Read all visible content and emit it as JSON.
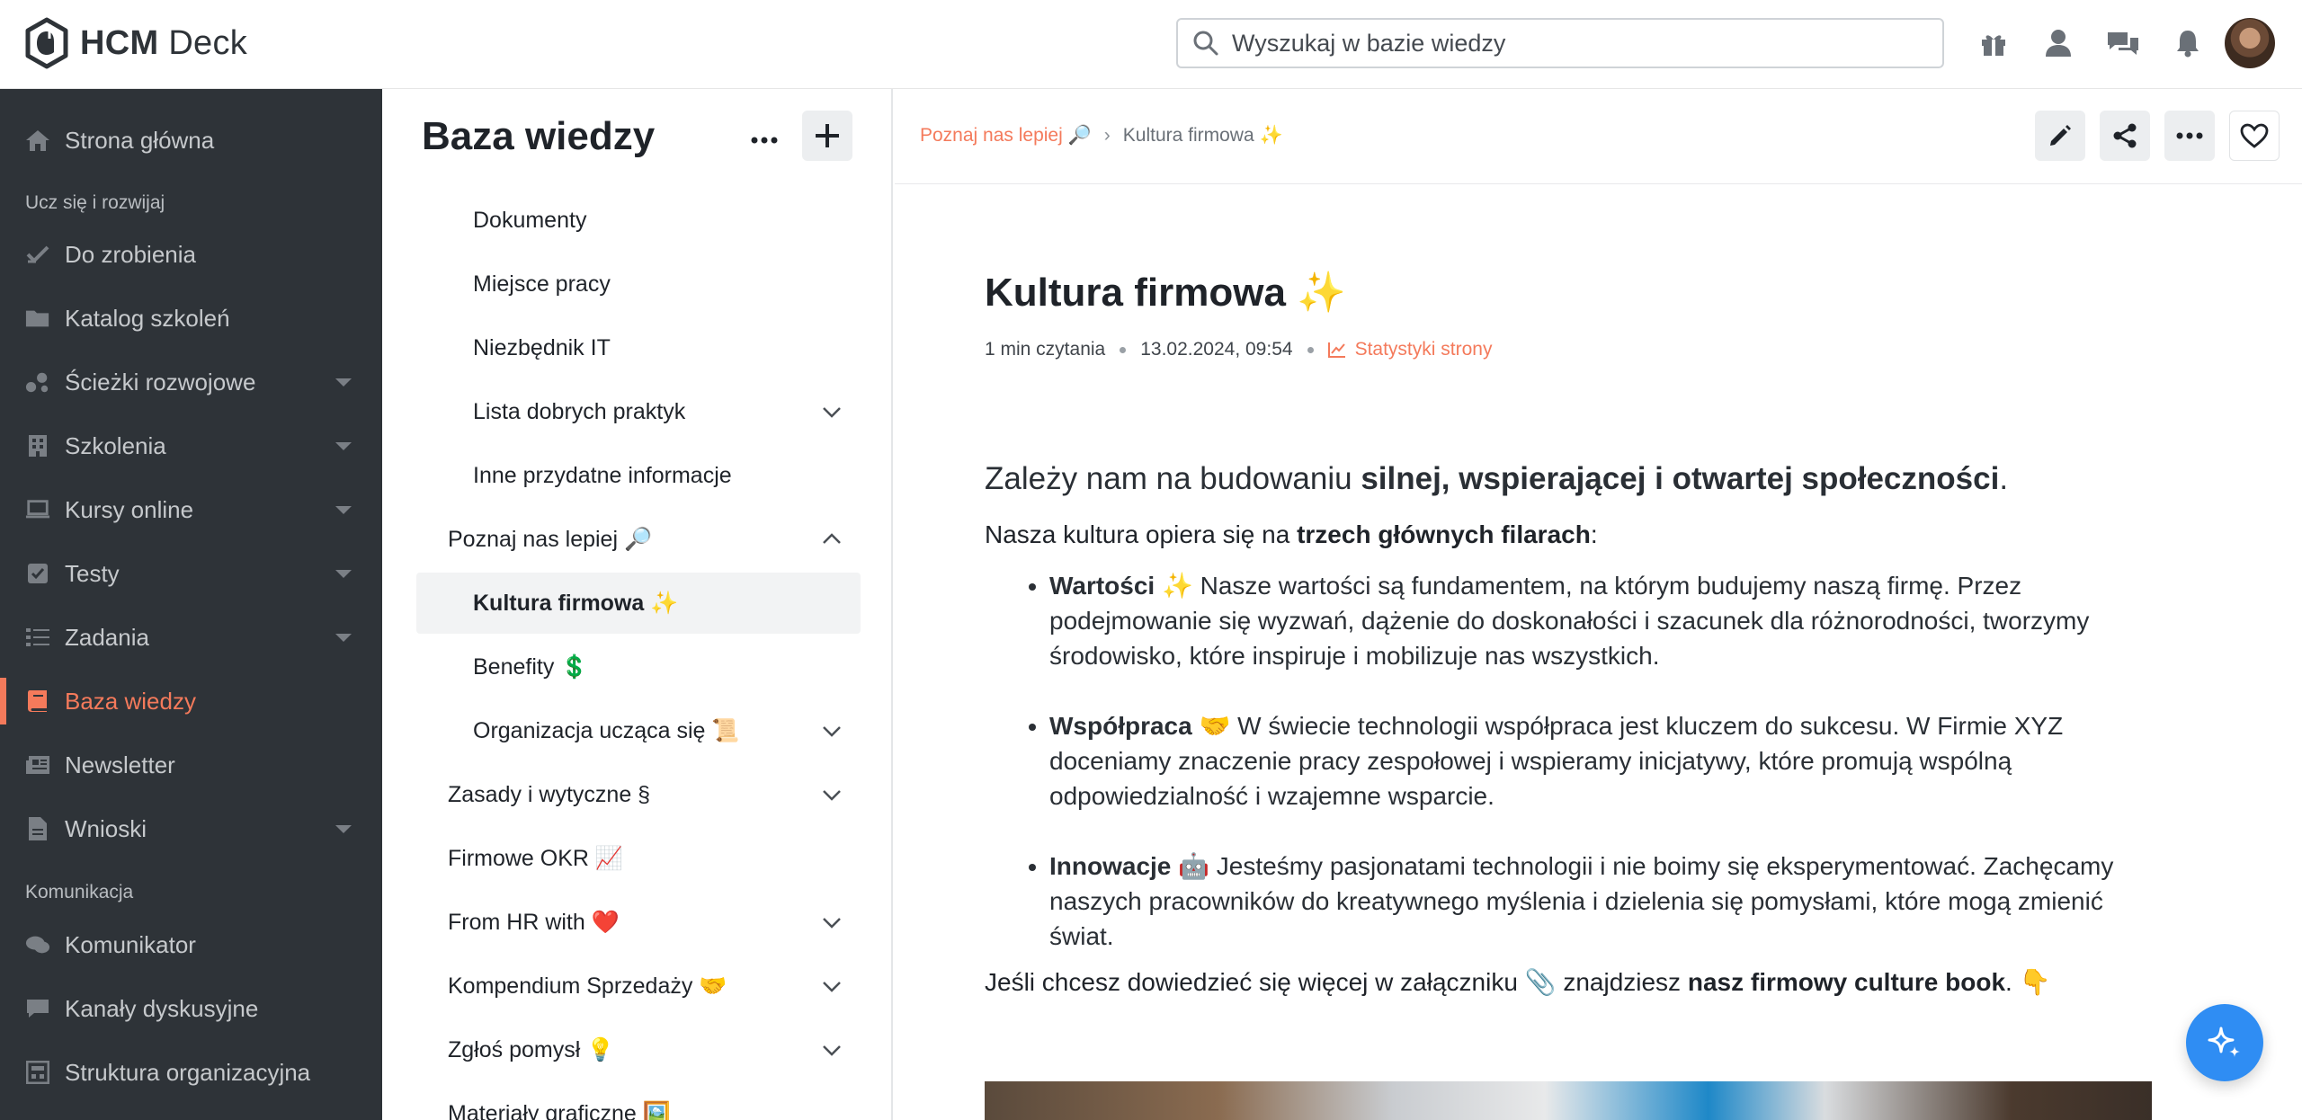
{
  "app": {
    "logo_bold": "HCM",
    "logo_light": "Deck"
  },
  "search": {
    "placeholder": "Wyszukaj w bazie wiedzy"
  },
  "sidebar": {
    "items": [
      {
        "label": "Strona główna",
        "icon": "home-icon"
      },
      {
        "label": "Do zrobienia",
        "icon": "check-icon"
      },
      {
        "label": "Katalog szkoleń",
        "icon": "folder-icon"
      },
      {
        "label": "Ścieżki rozwojowe",
        "icon": "paths-icon"
      },
      {
        "label": "Szkolenia",
        "icon": "building-icon"
      },
      {
        "label": "Kursy online",
        "icon": "laptop-icon"
      },
      {
        "label": "Testy",
        "icon": "checkbox-icon"
      },
      {
        "label": "Zadania",
        "icon": "tasks-icon"
      },
      {
        "label": "Baza wiedzy",
        "icon": "book-icon"
      },
      {
        "label": "Newsletter",
        "icon": "newspaper-icon"
      },
      {
        "label": "Wnioski",
        "icon": "document-icon"
      },
      {
        "label": "Komunikator",
        "icon": "chat-icon"
      },
      {
        "label": "Kanały dyskusyjne",
        "icon": "comment-icon"
      },
      {
        "label": "Struktura organizacyjna",
        "icon": "org-icon"
      }
    ],
    "sections": {
      "learn": "Ucz się i rozwijaj",
      "communication": "Komunikacja"
    }
  },
  "tree": {
    "title": "Baza wiedzy",
    "rows": [
      {
        "label": "Dokumenty"
      },
      {
        "label": "Miejsce pracy"
      },
      {
        "label": "Niezbędnik IT"
      },
      {
        "label": "Lista dobrych praktyk"
      },
      {
        "label": "Inne przydatne informacje"
      },
      {
        "label": "Poznaj nas lepiej 🔎"
      },
      {
        "label": "Kultura firmowa ✨"
      },
      {
        "label": "Benefity 💲"
      },
      {
        "label": "Organizacja ucząca się 📜"
      },
      {
        "label": "Zasady i wytyczne §"
      },
      {
        "label": "Firmowe OKR 📈"
      },
      {
        "label": "From HR with ❤️"
      },
      {
        "label": "Kompendium Sprzedaży 🤝"
      },
      {
        "label": "Zgłoś pomysł 💡"
      },
      {
        "label": "Materiały graficzne 🖼️"
      }
    ]
  },
  "breadcrumb": {
    "parent": "Poznaj nas lepiej 🔎",
    "separator": "›",
    "current": "Kultura firmowa ✨"
  },
  "article": {
    "title": "Kultura firmowa ✨",
    "read_time": "1 min czytania",
    "date": "13.02.2024, 09:54",
    "stats_link": "Statystyki strony",
    "lead_pre": "Zależy nam na budowaniu ",
    "lead_bold": "silnej, wspierającej i otwartej społeczności",
    "lead_post": ".",
    "intro_pre": "Nasza kultura opiera się na ",
    "intro_bold": "trzech głównych filarach",
    "intro_post": ":",
    "pillars": [
      {
        "name": "Wartości",
        "emoji": " ✨ ",
        "text": "Nasze wartości są fundamentem, na którym budujemy naszą firmę. Przez podejmowanie się wyzwań, dążenie do doskonałości i szacunek dla różnorodności, tworzymy środowisko, które inspiruje i mobilizuje nas wszystkich."
      },
      {
        "name": "Współpraca",
        "emoji": " 🤝 ",
        "text": "W świecie technologii współpraca jest kluczem do sukcesu. W Firmie XYZ doceniamy znaczenie pracy zespołowej i wspieramy inicjatywy, które promują wspólną odpowiedzialność i wzajemne wsparcie."
      },
      {
        "name": "Innowacje",
        "emoji": " 🤖 ",
        "text": "Jesteśmy pasjonatami technologii i nie boimy się eksperymentować. Zachęcamy naszych pracowników do kreatywnego myślenia i dzielenia się pomysłami, które mogą zmienić świat."
      }
    ],
    "outro_pre": "Jeśli chcesz dowiedzieć się więcej w załączniku 📎 znajdziesz ",
    "outro_bold": "nasz firmowy culture book",
    "outro_post": ". 👇"
  },
  "colors": {
    "accent": "#f47a5b",
    "sidebar_bg": "#2e3338",
    "fab": "#2f8df3"
  }
}
